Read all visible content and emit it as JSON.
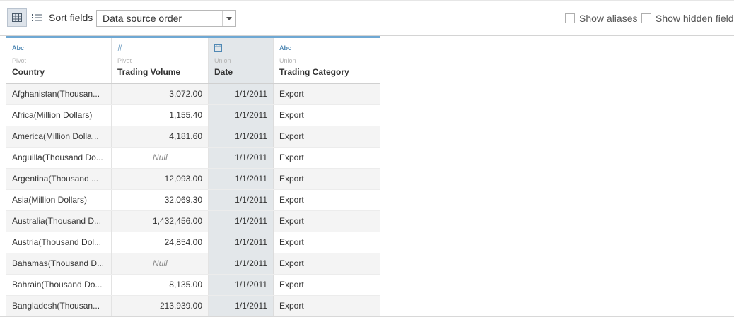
{
  "toolbar": {
    "grid_view_icon": "grid-icon",
    "list_view_icon": "list-icon",
    "sort_label": "Sort fields",
    "sort_value": "Data source order",
    "show_aliases": "Show aliases",
    "show_hidden": "Show hidden fields"
  },
  "columns": [
    {
      "type_icon": "Abc",
      "origin": "Pivot",
      "name": "Country"
    },
    {
      "type_icon": "#",
      "origin": "Pivot",
      "name": "Trading Volume"
    },
    {
      "type_icon": "calendar",
      "origin": "Union",
      "name": "Date"
    },
    {
      "type_icon": "Abc",
      "origin": "Union",
      "name": "Trading Category"
    }
  ],
  "rows": [
    {
      "country": "Afghanistan(Thousan...",
      "volume": "3,072.00",
      "date": "1/1/2011",
      "category": "Export"
    },
    {
      "country": "Africa(Million Dollars)",
      "volume": "1,155.40",
      "date": "1/1/2011",
      "category": "Export"
    },
    {
      "country": "America(Million Dolla...",
      "volume": "4,181.60",
      "date": "1/1/2011",
      "category": "Export"
    },
    {
      "country": "Anguilla(Thousand Do...",
      "volume": "Null",
      "date": "1/1/2011",
      "category": "Export"
    },
    {
      "country": "Argentina(Thousand ...",
      "volume": "12,093.00",
      "date": "1/1/2011",
      "category": "Export"
    },
    {
      "country": "Asia(Million Dollars)",
      "volume": "32,069.30",
      "date": "1/1/2011",
      "category": "Export"
    },
    {
      "country": "Australia(Thousand D...",
      "volume": "1,432,456.00",
      "date": "1/1/2011",
      "category": "Export"
    },
    {
      "country": "Austria(Thousand Dol...",
      "volume": "24,854.00",
      "date": "1/1/2011",
      "category": "Export"
    },
    {
      "country": "Bahamas(Thousand D...",
      "volume": "Null",
      "date": "1/1/2011",
      "category": "Export"
    },
    {
      "country": "Bahrain(Thousand Do...",
      "volume": "8,135.00",
      "date": "1/1/2011",
      "category": "Export"
    },
    {
      "country": "Bangladesh(Thousan...",
      "volume": "213,939.00",
      "date": "1/1/2011",
      "category": "Export"
    }
  ]
}
